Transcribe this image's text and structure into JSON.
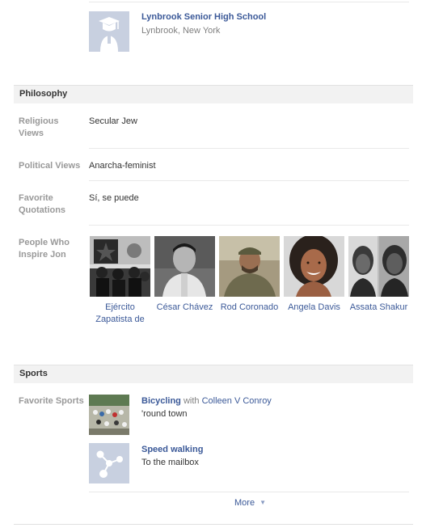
{
  "education": {
    "school_name": "Lynbrook Senior High School",
    "school_location": "Lynbrook, New York",
    "school_icon": "graduation-cap-icon"
  },
  "philosophy": {
    "title": "Philosophy",
    "religious": {
      "label": "Religious Views",
      "value": "Secular Jew"
    },
    "political": {
      "label": "Political Views",
      "value": "Anarcha-feminist"
    },
    "quotations": {
      "label": "Favorite Quotations",
      "value": "Sí, se puede"
    },
    "inspire": {
      "label": "People Who Inspire Jon",
      "people": [
        {
          "name": "Ejército Zapatista de"
        },
        {
          "name": "César Chávez"
        },
        {
          "name": "Rod Coronado"
        },
        {
          "name": "Angela Davis"
        },
        {
          "name": "Assata Shakur"
        }
      ]
    }
  },
  "sports": {
    "title": "Sports",
    "label": "Favorite Sports",
    "items": [
      {
        "name": "Bicycling",
        "with_text": "with",
        "with_person": "Colleen V Conroy",
        "description": "'round town"
      },
      {
        "name": "Speed walking",
        "description": "To the mailbox",
        "icon": "connection-nodes-icon"
      }
    ],
    "more_label": "More",
    "more_icon": "caret-down-icon"
  },
  "colors": {
    "link": "#3b5998",
    "label_gray": "#999999",
    "header_bg": "#f2f2f2",
    "placeholder_bg": "#c8d0e0"
  }
}
